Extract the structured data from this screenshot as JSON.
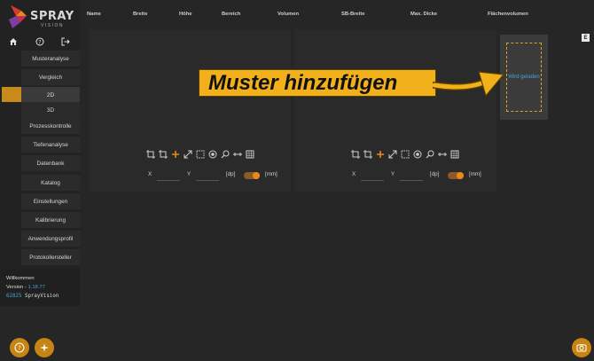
{
  "brand": {
    "name": "SPRAY",
    "subtitle": "VISION"
  },
  "topicons": [
    "home-icon",
    "help-icon",
    "logout-icon"
  ],
  "nav": {
    "items": [
      {
        "label": "Musteranalyse",
        "key": "musteranalyse"
      },
      {
        "label": "Vergleich",
        "key": "vergleich"
      },
      {
        "label": "2D",
        "key": "2d",
        "sub": true,
        "active": true
      },
      {
        "label": "3D",
        "key": "3d",
        "sub": true
      },
      {
        "label": "Prozesskontrolle",
        "key": "prozesskontrolle"
      },
      {
        "label": "Tiefenanalyse",
        "key": "tiefenanalyse"
      },
      {
        "label": "Datenbank",
        "key": "datenbank"
      },
      {
        "label": "Katalog",
        "key": "katalog"
      },
      {
        "label": "Einstellungen",
        "key": "einstellungen"
      },
      {
        "label": "Kalibrierung",
        "key": "kalibrierung"
      },
      {
        "label": "Anwendungsprofil",
        "key": "anwendungsprofil"
      },
      {
        "label": "Protokollersteller",
        "key": "protokollersteller"
      }
    ]
  },
  "info": {
    "welcome": "Willkommen",
    "version_label": "Version - ",
    "version": "1.18.77",
    "device_id": "62825",
    "device_name": "SprayVision"
  },
  "columns": [
    "Name",
    "Breite",
    "Höhe",
    "Bereich",
    "Volumen",
    "SB-Breite",
    "Max. Dicke",
    "Flächenvolumen"
  ],
  "panel": {
    "x_label": "X",
    "y_label": "Y",
    "unit_dp": "[dp]",
    "unit_mm": "[mm]",
    "unit_toggle_mm": true
  },
  "loading_card": {
    "text": "Wird geladen"
  },
  "export_label": "E",
  "callout": {
    "text": "Muster hinzufügen"
  },
  "colors": {
    "accent": "#e88a1a",
    "callout": "#f2b11a",
    "link": "#3fa7d6"
  }
}
